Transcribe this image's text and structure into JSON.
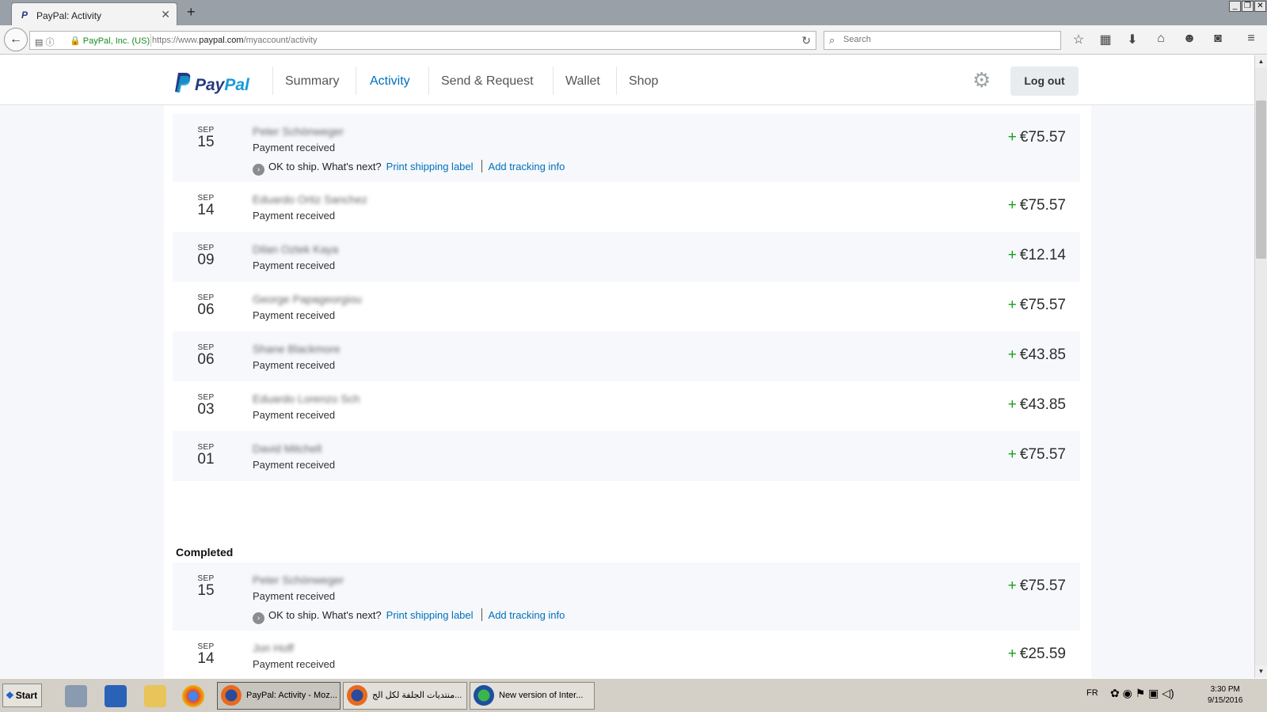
{
  "browser": {
    "tab_title": "PayPal: Activity",
    "identity": "PayPal, Inc. (US)",
    "url_prefix": "https://www.",
    "url_domain": "paypal.com",
    "url_path": "/myaccount/activity",
    "search_placeholder": "Search"
  },
  "header": {
    "logo_part1": "Pay",
    "logo_part2": "Pal",
    "nav": [
      "Summary",
      "Activity",
      "Send & Request",
      "Wallet",
      "Shop"
    ],
    "active_nav": "Activity",
    "logout_label": "Log out"
  },
  "section_completed_title": "Completed",
  "transactions_top": [
    {
      "month": "SEP",
      "day": "15",
      "name": "Peter Schönweger",
      "type": "Payment received",
      "amount": "€75.57",
      "has_shipping": true
    },
    {
      "month": "SEP",
      "day": "14",
      "name": "Eduardo Ortiz Sanchez",
      "type": "Payment received",
      "amount": "€75.57",
      "has_shipping": false
    },
    {
      "month": "SEP",
      "day": "09",
      "name": "Dilan Oztek Kaya",
      "type": "Payment received",
      "amount": "€12.14",
      "has_shipping": false
    },
    {
      "month": "SEP",
      "day": "06",
      "name": "George Papageorgiou",
      "type": "Payment received",
      "amount": "€75.57",
      "has_shipping": false
    },
    {
      "month": "SEP",
      "day": "06",
      "name": "Shane Blackmore",
      "type": "Payment received",
      "amount": "€43.85",
      "has_shipping": false
    },
    {
      "month": "SEP",
      "day": "03",
      "name": "Eduardo Lorenzo Sch",
      "type": "Payment received",
      "amount": "€43.85",
      "has_shipping": false
    },
    {
      "month": "SEP",
      "day": "01",
      "name": "David Mitchell",
      "type": "Payment received",
      "amount": "€75.57",
      "has_shipping": false
    }
  ],
  "transactions_completed": [
    {
      "month": "SEP",
      "day": "15",
      "name": "Peter Schönweger",
      "type": "Payment received",
      "amount": "€75.57",
      "has_shipping": true
    },
    {
      "month": "SEP",
      "day": "14",
      "name": "Jon Hoff",
      "type": "Payment received",
      "amount": "€25.59",
      "has_shipping": false
    }
  ],
  "shipping": {
    "status": "OK to ship. What's next?",
    "print_label": "Print shipping label",
    "tracking_label": "Add tracking info"
  },
  "taskbar": {
    "start_label": "Start",
    "windows": [
      "PayPal: Activity - Moz...",
      "منتديات الجلفة لكل الج...",
      "New version of Inter..."
    ],
    "language": "FR",
    "time": "3:30 PM",
    "date": "9/15/2016"
  },
  "colors": {
    "paypal_dark_blue": "#253b80",
    "paypal_light_blue": "#179bd7",
    "link_blue": "#0070ba",
    "plus_green": "#1b9f1b"
  }
}
